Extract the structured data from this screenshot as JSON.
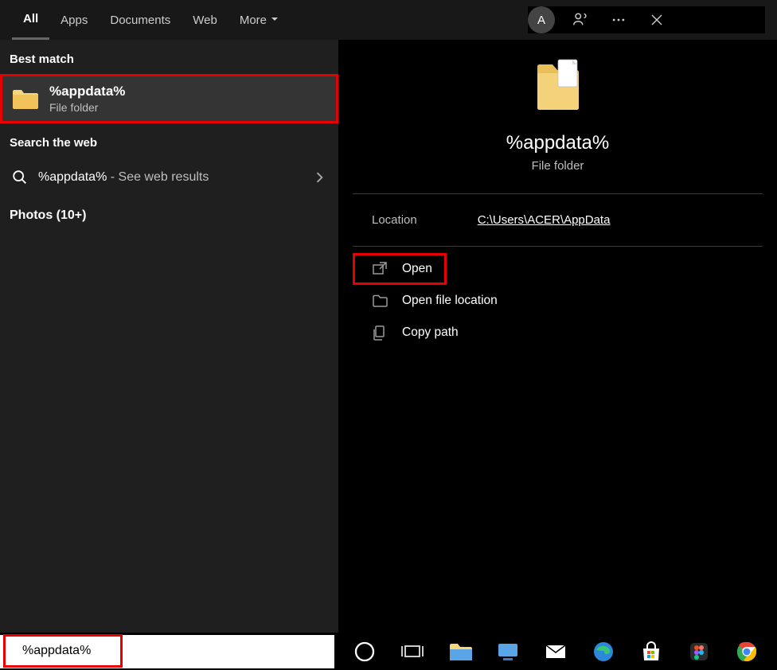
{
  "tabs": {
    "all": "All",
    "apps": "Apps",
    "documents": "Documents",
    "web": "Web",
    "more": "More"
  },
  "avatar": {
    "letter": "A"
  },
  "left": {
    "best_match_label": "Best match",
    "result": {
      "title": "%appdata%",
      "subtitle": "File folder"
    },
    "search_web_label": "Search the web",
    "web": {
      "query": "%appdata%",
      "hint": " - See web results"
    },
    "photos_label": "Photos (10+)"
  },
  "preview": {
    "title": "%appdata%",
    "subtitle": "File folder",
    "location_label": "Location",
    "location_path": "C:\\Users\\ACER\\AppData",
    "actions": {
      "open": "Open",
      "open_file_location": "Open file location",
      "copy_path": "Copy path"
    }
  },
  "searchbox": {
    "value": "%appdata%"
  }
}
